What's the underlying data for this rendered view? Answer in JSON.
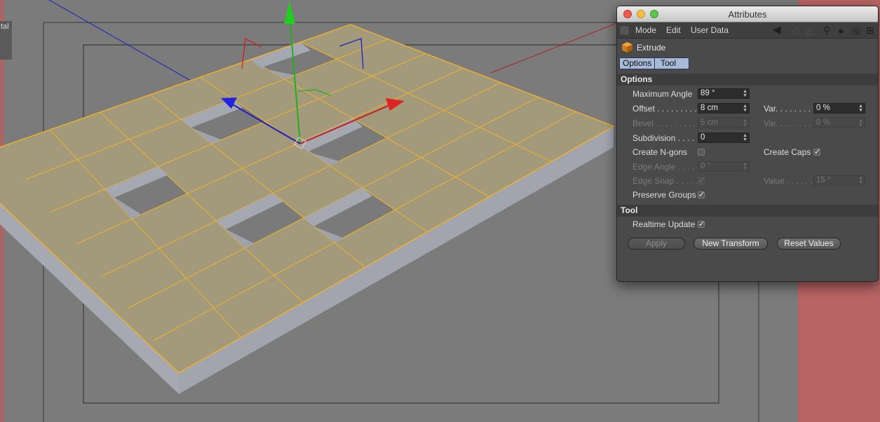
{
  "viewport": {
    "corner_label": "tal",
    "colors": {
      "background": "#7a7a7a",
      "poly_fill": "#a39a7c",
      "edge_highlight": "#f0b12a",
      "side_face": "#a4a7b1",
      "safe_frame_red": "#b86464"
    },
    "gizmo_icons": [
      "y-axis-arrow-icon",
      "x-axis-arrow-icon",
      "z-axis-arrow-icon",
      "pivot-cube-icon"
    ]
  },
  "window": {
    "title": "Attributes",
    "menu": [
      "Mode",
      "Edit",
      "User Data"
    ],
    "toolbar_icons": [
      "back-arrow-icon",
      "forward-arrow-icon",
      "search-icon",
      "lock-icon",
      "target-icon",
      "new-panel-icon"
    ],
    "object_name": "Extrude",
    "object_icon": "extrude-cube-icon",
    "tabs": [
      "Options",
      "Tool"
    ],
    "options": {
      "title": "Options",
      "maximum_angle": {
        "label": "Maximum Angle",
        "value": "89 °"
      },
      "offset": {
        "label": "Offset . . . . . . . . .",
        "value": "8 cm"
      },
      "offset_var": {
        "label": "Var. . . . . . . . .",
        "value": "0 %"
      },
      "bevel": {
        "label": "Bevel . . . . . . . . .",
        "value": "5 cm"
      },
      "bevel_var": {
        "label": "Var. . . . . . . . .",
        "value": "0 %"
      },
      "subdivision": {
        "label": "Subdivision . . . .",
        "value": "0"
      },
      "create_ngons": {
        "label": "Create N-gons",
        "checked": false
      },
      "create_caps": {
        "label": "Create Caps",
        "checked": true
      },
      "edge_angle": {
        "label": "Edge Angle . . . .",
        "value": "0 °"
      },
      "edge_snap": {
        "label": "Edge Snap . . . . .",
        "checked": true
      },
      "edge_value": {
        "label": "Value . . . . . .",
        "value": "15 °"
      },
      "preserve_groups": {
        "label": "Preserve Groups",
        "checked": true
      }
    },
    "tool": {
      "title": "Tool",
      "realtime_update": {
        "label": "Realtime Update",
        "checked": true
      },
      "apply_label": "Apply",
      "new_transform_label": "New Transform",
      "reset_values_label": "Reset Values"
    },
    "checkmark": "✓"
  }
}
